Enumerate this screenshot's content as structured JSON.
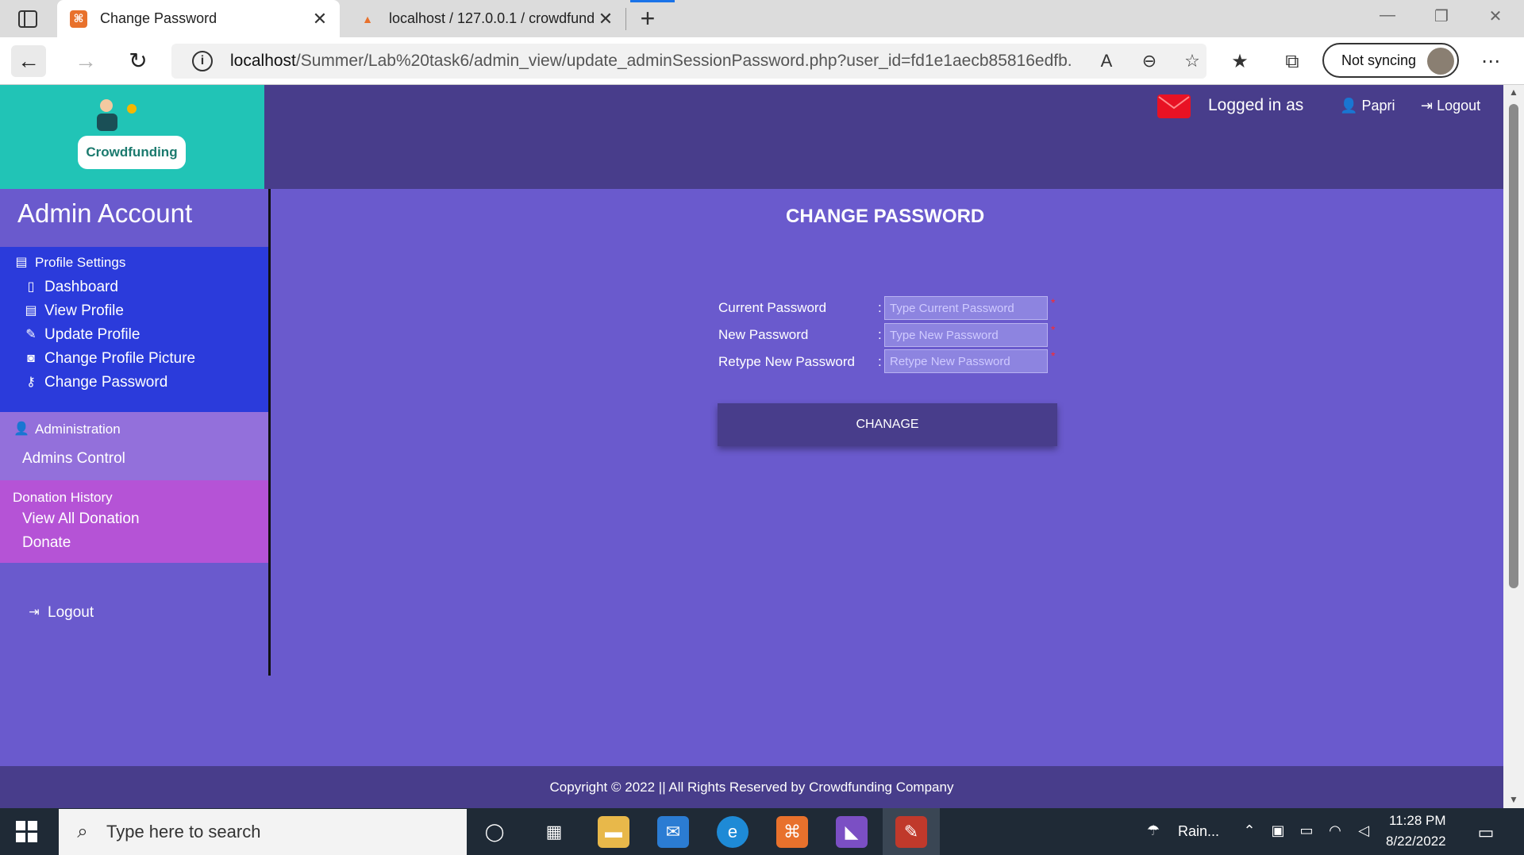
{
  "browser": {
    "tabs": [
      {
        "title": "Change Password",
        "active": true,
        "favicon": "xampp-icon"
      },
      {
        "title": "localhost / 127.0.0.1 / crowdfund",
        "active": false,
        "favicon": "phpmyadmin-icon"
      }
    ],
    "url_host": "localhost",
    "url_path": "/Summer/Lab%20task6/admin_view/update_adminSessionPassword.php?user_id=fd1e1aecb85816edfb...",
    "sync_label": "Not syncing"
  },
  "header": {
    "logo_text": "Crowdfunding",
    "logged_in_label": "Logged in as",
    "user_name": "Papri",
    "logout_label": "Logout"
  },
  "sidebar": {
    "title": "Admin Account",
    "profile_section": {
      "heading": "Profile Settings",
      "items": [
        "Dashboard",
        "View Profile",
        "Update Profile",
        "Change Profile Picture",
        "Change Password"
      ]
    },
    "admin_section": {
      "heading": "Administration",
      "items": [
        "Admins Control"
      ]
    },
    "donation_section": {
      "heading": "Donation History",
      "items": [
        "View All Donation",
        "Donate"
      ]
    },
    "logout_label": "Logout"
  },
  "form": {
    "title": "CHANGE PASSWORD",
    "fields": [
      {
        "label": "Current Password",
        "placeholder": "Type Current Password"
      },
      {
        "label": "New Password",
        "placeholder": "Type New Password"
      },
      {
        "label": "Retype New Password",
        "placeholder": "Retype New Password"
      }
    ],
    "colon": ":",
    "required_mark": "*",
    "submit_label": "CHANAGE"
  },
  "footer": {
    "text": "Copyright © 2022 || All Rights Reserved by Crowdfunding Company"
  },
  "taskbar": {
    "search_placeholder": "Type here to search",
    "weather": "Rain...",
    "time": "11:28 PM",
    "date": "8/22/2022"
  },
  "colors": {
    "page_bg": "#6a5acd",
    "header_bg": "#483d8b",
    "logo_bg": "#21c4b6",
    "profile_section_bg": "#2b3bdb",
    "admin_section_bg": "#9370db",
    "donation_section_bg": "#b553d6",
    "required": "#ff2a2a"
  }
}
